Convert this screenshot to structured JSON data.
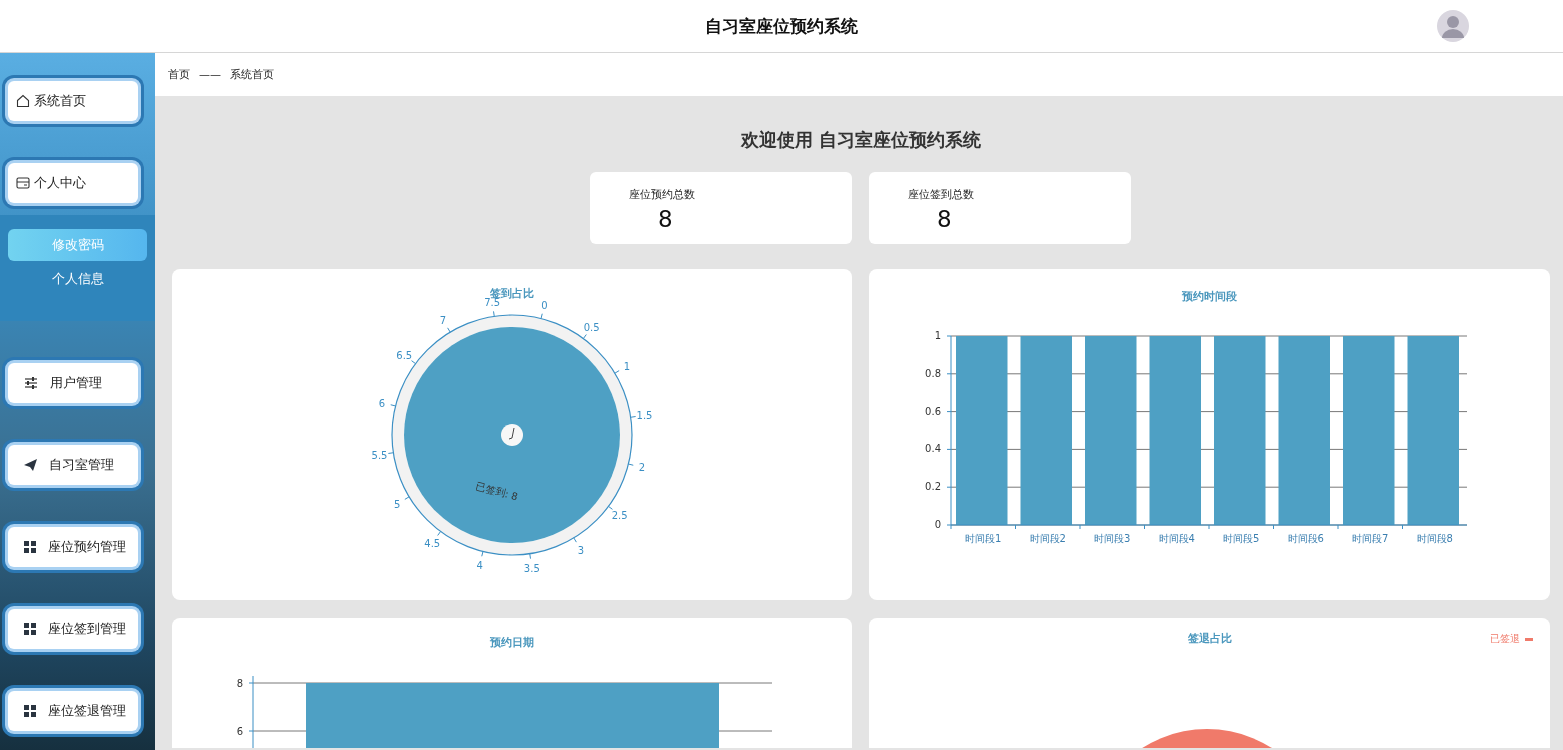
{
  "header": {
    "title": "自习室座位预约系统"
  },
  "sidebar": {
    "items": [
      {
        "label": "系统首页"
      },
      {
        "label": "个人中心",
        "children": [
          {
            "label": "修改密码",
            "selected": true
          },
          {
            "label": "个人信息",
            "selected": false
          }
        ]
      },
      {
        "label": "用户管理"
      },
      {
        "label": "自习室管理"
      },
      {
        "label": "座位预约管理"
      },
      {
        "label": "座位签到管理"
      },
      {
        "label": "座位签退管理"
      }
    ]
  },
  "breadcrumb": {
    "items": [
      "首页",
      "系统首页"
    ],
    "separator": "——"
  },
  "welcome": "欢迎使用 自习室座位预约系统",
  "stats": [
    {
      "label": "座位预约总数",
      "value": "8"
    },
    {
      "label": "座位签到总数",
      "value": "8"
    }
  ],
  "gauge": {
    "title": "签到占比",
    "axis_labels": [
      "0",
      "0.5",
      "1",
      "1.5",
      "2",
      "2.5",
      "3",
      "3.5",
      "4",
      "4.5",
      "5",
      "5.5",
      "6",
      "6.5",
      "7",
      "7.5"
    ],
    "value_label": "已签到: 8"
  },
  "time_slots": {
    "title": "预约时间段",
    "chart_data": {
      "type": "bar",
      "categories": [
        "时间段1",
        "时间段2",
        "时间段3",
        "时间段4",
        "时间段5",
        "时间段6",
        "时间段7",
        "时间段8"
      ],
      "values": [
        1,
        1,
        1,
        1,
        1,
        1,
        1,
        1
      ],
      "ylim": [
        0,
        1
      ],
      "yticks": [
        0,
        0.2,
        0.4,
        0.6,
        0.8,
        1
      ],
      "grid": true
    }
  },
  "dates": {
    "title": "预约日期",
    "chart_data": {
      "type": "bar",
      "values": [
        8
      ],
      "ylim": [
        0,
        8
      ],
      "yticks": [
        6,
        8
      ],
      "grid": true
    }
  },
  "checkout": {
    "title": "签退占比",
    "legend": [
      {
        "label": "已签退",
        "color": "#f07a6a"
      }
    ]
  }
}
